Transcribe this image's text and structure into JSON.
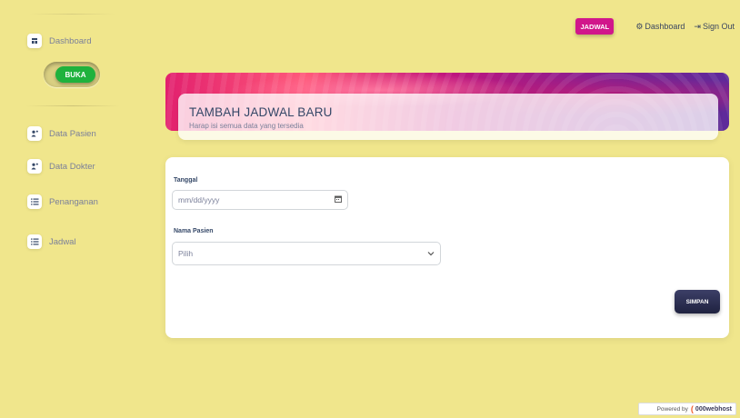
{
  "sidebar": {
    "dashboard_label": "Dashboard",
    "buka_label": "BUKA",
    "items": [
      {
        "label": "Data Pasien",
        "icon": "user-group-icon"
      },
      {
        "label": "Data Dokter",
        "icon": "user-group-icon"
      },
      {
        "label": "Penanganan",
        "icon": "list-icon"
      },
      {
        "label": "Jadwal",
        "icon": "list-icon"
      }
    ]
  },
  "topbar": {
    "jadwal_label": "JADWAL",
    "dashboard_label": "Dashboard",
    "signout_label": "Sign Out"
  },
  "header": {
    "title": "TAMBAH JADWAL BARU",
    "subtitle": "Harap isi semua data yang tersedia"
  },
  "form": {
    "tanggal_label": "Tanggal",
    "tanggal_placeholder": "mm/dd/yyyy",
    "pasien_label": "Nama Pasien",
    "pasien_selected": "Pilih",
    "submit_label": "SIMPAN"
  },
  "footer": {
    "powered_label": "Powered by",
    "brand": "000webhost"
  },
  "colors": {
    "background": "#f0e68c",
    "accent_pink": "#d1168b",
    "buka_green": "#1fb23d",
    "submit_dark": "#1f2240"
  }
}
